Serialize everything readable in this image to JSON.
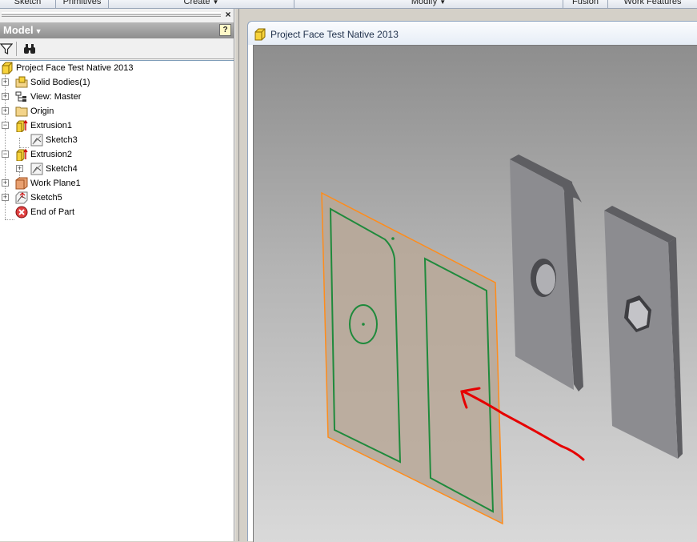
{
  "ribbon": {
    "panels": [
      {
        "label": "Sketch",
        "has_dropdown": false
      },
      {
        "label": "Primitives",
        "has_dropdown": false
      },
      {
        "label": "Create",
        "has_dropdown": true
      },
      {
        "label": "Modify",
        "has_dropdown": true
      },
      {
        "label": "Fusion",
        "has_dropdown": false
      },
      {
        "label": "Work Features",
        "has_dropdown": false
      }
    ]
  },
  "browser": {
    "header": "Model",
    "help_label": "?",
    "close_label": "×",
    "tree": [
      {
        "label": "Project Face Test Native 2013",
        "icon": "part-icon",
        "level": 0,
        "expander": "none"
      },
      {
        "label": "Solid Bodies(1)",
        "icon": "solid-bodies-folder-icon",
        "level": 1,
        "expander": "plus"
      },
      {
        "label": "View: Master",
        "icon": "view-representation-icon",
        "level": 1,
        "expander": "plus"
      },
      {
        "label": "Origin",
        "icon": "origin-folder-icon",
        "level": 1,
        "expander": "plus"
      },
      {
        "label": "Extrusion1",
        "icon": "extrusion-icon",
        "level": 1,
        "expander": "minus"
      },
      {
        "label": "Sketch3",
        "icon": "sketch-icon",
        "level": 2,
        "expander": "none"
      },
      {
        "label": "Extrusion2",
        "icon": "extrusion-icon",
        "level": 1,
        "expander": "minus"
      },
      {
        "label": "Sketch4",
        "icon": "sketch-icon",
        "level": 2,
        "expander": "plus"
      },
      {
        "label": "Work Plane1",
        "icon": "work-plane-icon",
        "level": 1,
        "expander": "plus"
      },
      {
        "label": "Sketch5",
        "icon": "sketch-3d-icon",
        "level": 1,
        "expander": "plus"
      },
      {
        "label": "End of Part",
        "icon": "end-of-part-icon",
        "level": 1,
        "expander": "none"
      }
    ]
  },
  "graphics": {
    "title": "Project Face Test Native 2013",
    "colors": {
      "work_plane_fill": "#b8a898",
      "work_plane_edge": "#ff8c1a",
      "sketch_lines": "#1f8a3c",
      "annotation_arrow": "#e60000",
      "part_face": "#8c8c90",
      "part_side": "#5e5e62"
    }
  }
}
